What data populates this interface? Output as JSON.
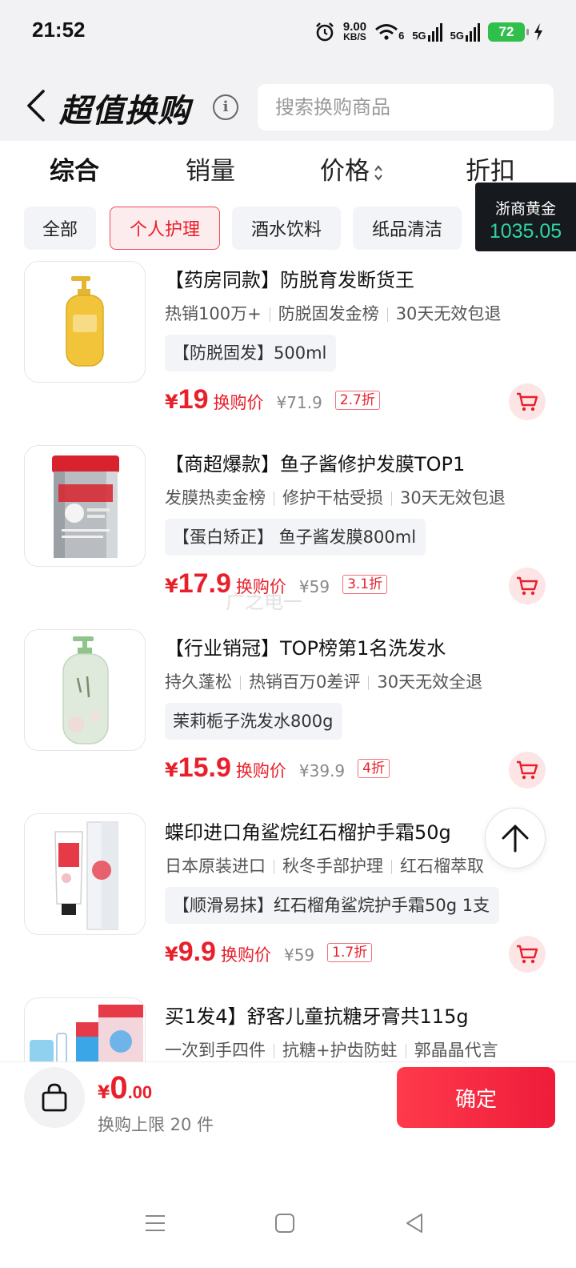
{
  "status_bar": {
    "time": "21:52",
    "net_speed_value": "9.00",
    "net_speed_unit": "KB/S",
    "wifi_label": "6",
    "signal1": "5G",
    "signal2": "5G",
    "battery": "72"
  },
  "header": {
    "title": "超值换购",
    "search_placeholder": "搜索换购商品"
  },
  "sort_tabs": [
    {
      "label": "综合",
      "active": true
    },
    {
      "label": "销量",
      "active": false
    },
    {
      "label": "价格",
      "active": false
    },
    {
      "label": "折扣",
      "active": false
    }
  ],
  "chips": [
    {
      "label": "全部",
      "active": false
    },
    {
      "label": "个人护理",
      "active": true
    },
    {
      "label": "酒水饮料",
      "active": false
    },
    {
      "label": "纸品清洁",
      "active": false
    }
  ],
  "gold": {
    "name": "浙商黄金",
    "price": "1035.05"
  },
  "price_label": "换购价",
  "currency": "¥",
  "products": [
    {
      "title": "【药房同款】防脱育发断货王",
      "tags": [
        "热销100万+",
        "防脱固发金榜",
        "30天无效包退"
      ],
      "spec": "【防脱固发】500ml",
      "price": "19",
      "original": "¥71.9",
      "discount": "2.7折"
    },
    {
      "title": "【商超爆款】鱼子酱修护发膜TOP1",
      "tags": [
        "发膜热卖金榜",
        "修护干枯受损",
        "30天无效包退"
      ],
      "spec": "【蛋白矫正】 鱼子酱发膜800ml",
      "price": "17.9",
      "original": "¥59",
      "discount": "3.1折"
    },
    {
      "title": "【行业销冠】TOP榜第1名洗发水",
      "tags": [
        "持久蓬松",
        "热销百万0差评",
        "30天无效全退"
      ],
      "spec": "茉莉栀子洗发水800g",
      "price": "15.9",
      "original": "¥39.9",
      "discount": "4折"
    },
    {
      "title": "蝶印进口角鲨烷红石榴护手霜50g",
      "tags": [
        "日本原装进口",
        "秋冬手部护理",
        "红石榴萃取"
      ],
      "spec": "【顺滑易抹】红石榴角鲨烷护手霜50g 1支",
      "price": "9.9",
      "original": "¥59",
      "discount": "1.7折"
    },
    {
      "title": "买1发4】舒客儿童抗糖牙膏共115g",
      "tags": [
        "一次到手四件",
        "抗糖+护齿防蛀",
        "郭晶晶代言"
      ],
      "spec": "",
      "price": "",
      "original": "",
      "discount": ""
    }
  ],
  "watermark": "广之电一",
  "bottom": {
    "currency": "¥",
    "total_int": "0",
    "total_dec": ".00",
    "limit": "换购上限 20 件",
    "confirm": "确定"
  },
  "colors": {
    "accent": "#e8202c",
    "gold_price": "#2fd4a4",
    "chip_bg": "#f3f4f7"
  }
}
